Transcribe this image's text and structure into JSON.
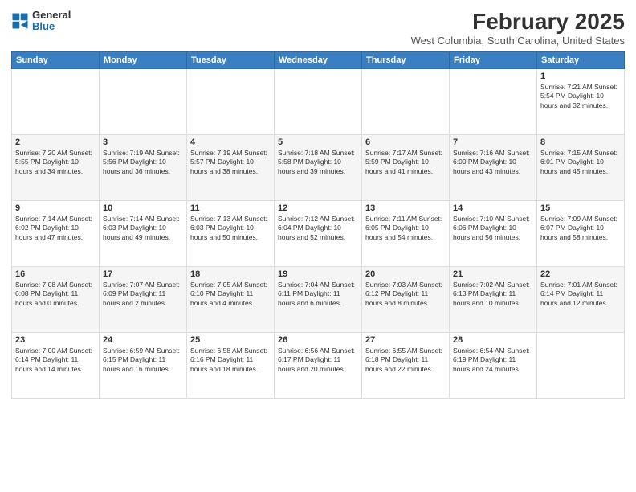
{
  "header": {
    "logo_general": "General",
    "logo_blue": "Blue",
    "month_title": "February 2025",
    "location": "West Columbia, South Carolina, United States"
  },
  "days_of_week": [
    "Sunday",
    "Monday",
    "Tuesday",
    "Wednesday",
    "Thursday",
    "Friday",
    "Saturday"
  ],
  "weeks": [
    [
      {
        "num": "",
        "info": ""
      },
      {
        "num": "",
        "info": ""
      },
      {
        "num": "",
        "info": ""
      },
      {
        "num": "",
        "info": ""
      },
      {
        "num": "",
        "info": ""
      },
      {
        "num": "",
        "info": ""
      },
      {
        "num": "1",
        "info": "Sunrise: 7:21 AM\nSunset: 5:54 PM\nDaylight: 10 hours and 32 minutes."
      }
    ],
    [
      {
        "num": "2",
        "info": "Sunrise: 7:20 AM\nSunset: 5:55 PM\nDaylight: 10 hours and 34 minutes."
      },
      {
        "num": "3",
        "info": "Sunrise: 7:19 AM\nSunset: 5:56 PM\nDaylight: 10 hours and 36 minutes."
      },
      {
        "num": "4",
        "info": "Sunrise: 7:19 AM\nSunset: 5:57 PM\nDaylight: 10 hours and 38 minutes."
      },
      {
        "num": "5",
        "info": "Sunrise: 7:18 AM\nSunset: 5:58 PM\nDaylight: 10 hours and 39 minutes."
      },
      {
        "num": "6",
        "info": "Sunrise: 7:17 AM\nSunset: 5:59 PM\nDaylight: 10 hours and 41 minutes."
      },
      {
        "num": "7",
        "info": "Sunrise: 7:16 AM\nSunset: 6:00 PM\nDaylight: 10 hours and 43 minutes."
      },
      {
        "num": "8",
        "info": "Sunrise: 7:15 AM\nSunset: 6:01 PM\nDaylight: 10 hours and 45 minutes."
      }
    ],
    [
      {
        "num": "9",
        "info": "Sunrise: 7:14 AM\nSunset: 6:02 PM\nDaylight: 10 hours and 47 minutes."
      },
      {
        "num": "10",
        "info": "Sunrise: 7:14 AM\nSunset: 6:03 PM\nDaylight: 10 hours and 49 minutes."
      },
      {
        "num": "11",
        "info": "Sunrise: 7:13 AM\nSunset: 6:03 PM\nDaylight: 10 hours and 50 minutes."
      },
      {
        "num": "12",
        "info": "Sunrise: 7:12 AM\nSunset: 6:04 PM\nDaylight: 10 hours and 52 minutes."
      },
      {
        "num": "13",
        "info": "Sunrise: 7:11 AM\nSunset: 6:05 PM\nDaylight: 10 hours and 54 minutes."
      },
      {
        "num": "14",
        "info": "Sunrise: 7:10 AM\nSunset: 6:06 PM\nDaylight: 10 hours and 56 minutes."
      },
      {
        "num": "15",
        "info": "Sunrise: 7:09 AM\nSunset: 6:07 PM\nDaylight: 10 hours and 58 minutes."
      }
    ],
    [
      {
        "num": "16",
        "info": "Sunrise: 7:08 AM\nSunset: 6:08 PM\nDaylight: 11 hours and 0 minutes."
      },
      {
        "num": "17",
        "info": "Sunrise: 7:07 AM\nSunset: 6:09 PM\nDaylight: 11 hours and 2 minutes."
      },
      {
        "num": "18",
        "info": "Sunrise: 7:05 AM\nSunset: 6:10 PM\nDaylight: 11 hours and 4 minutes."
      },
      {
        "num": "19",
        "info": "Sunrise: 7:04 AM\nSunset: 6:11 PM\nDaylight: 11 hours and 6 minutes."
      },
      {
        "num": "20",
        "info": "Sunrise: 7:03 AM\nSunset: 6:12 PM\nDaylight: 11 hours and 8 minutes."
      },
      {
        "num": "21",
        "info": "Sunrise: 7:02 AM\nSunset: 6:13 PM\nDaylight: 11 hours and 10 minutes."
      },
      {
        "num": "22",
        "info": "Sunrise: 7:01 AM\nSunset: 6:14 PM\nDaylight: 11 hours and 12 minutes."
      }
    ],
    [
      {
        "num": "23",
        "info": "Sunrise: 7:00 AM\nSunset: 6:14 PM\nDaylight: 11 hours and 14 minutes."
      },
      {
        "num": "24",
        "info": "Sunrise: 6:59 AM\nSunset: 6:15 PM\nDaylight: 11 hours and 16 minutes."
      },
      {
        "num": "25",
        "info": "Sunrise: 6:58 AM\nSunset: 6:16 PM\nDaylight: 11 hours and 18 minutes."
      },
      {
        "num": "26",
        "info": "Sunrise: 6:56 AM\nSunset: 6:17 PM\nDaylight: 11 hours and 20 minutes."
      },
      {
        "num": "27",
        "info": "Sunrise: 6:55 AM\nSunset: 6:18 PM\nDaylight: 11 hours and 22 minutes."
      },
      {
        "num": "28",
        "info": "Sunrise: 6:54 AM\nSunset: 6:19 PM\nDaylight: 11 hours and 24 minutes."
      },
      {
        "num": "",
        "info": ""
      }
    ]
  ]
}
